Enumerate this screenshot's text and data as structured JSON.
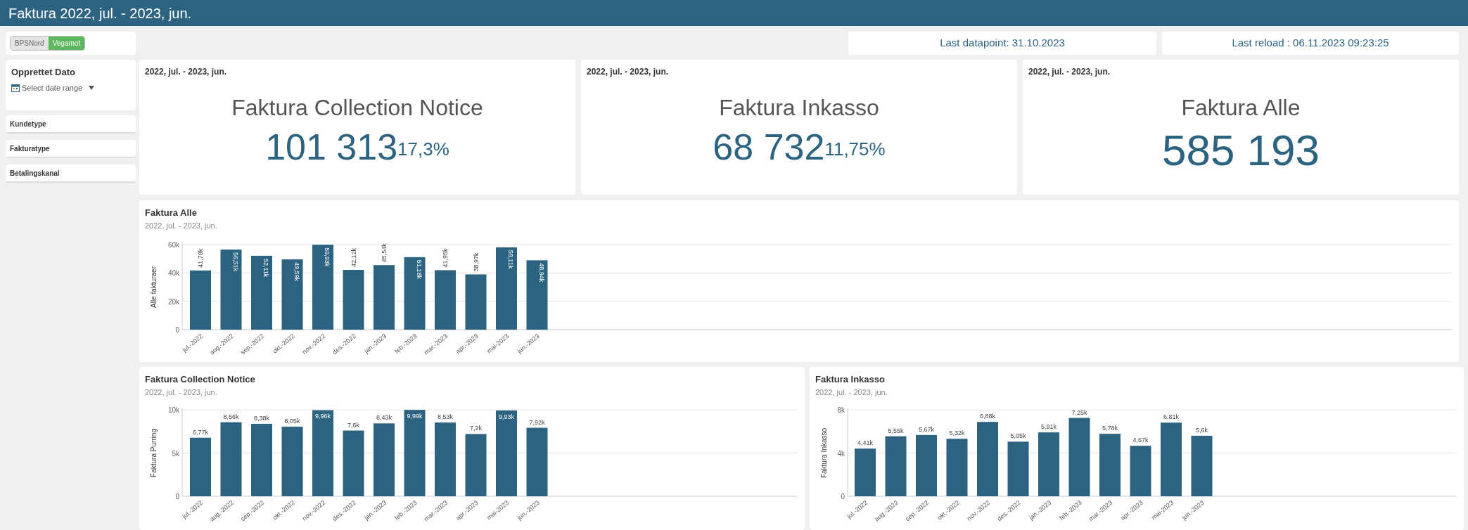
{
  "window": {
    "title": "Faktura 2022, jul. - 2023, jun."
  },
  "company_toggle": [
    {
      "label": "BPSNord",
      "selected": false
    },
    {
      "label": "Vegamot",
      "selected": true
    }
  ],
  "filters": {
    "date": {
      "title": "Opprettet Dato",
      "placeholder": "Select date range"
    },
    "items": [
      "Kundetype",
      "Fakturatype",
      "Betalingskanal"
    ]
  },
  "info": [
    "Last datapoint: 31.10.2023",
    "Last reload : 06.11.2023 09:23:25"
  ],
  "kpis": [
    {
      "period": "2022, jul. - 2023, jun.",
      "title": "Faktura Collection Notice",
      "value": "101 313",
      "percent": "17,3%"
    },
    {
      "period": "2022, jul. - 2023, jun.",
      "title": "Faktura Inkasso",
      "value": "68 732",
      "percent": "11,75%"
    },
    {
      "period": "2022, jul. - 2023, jun.",
      "title": "Faktura Alle",
      "value": "585 193"
    }
  ],
  "charts": [
    {
      "title": "Faktura Alle",
      "subtitle": "2022, jul. - 2023, jun.",
      "chart_data": {
        "type": "bar",
        "ylabel": "Alle fakturaer",
        "categories": [
          "jul.-2022",
          "aug.-2022",
          "sep.-2022",
          "okt.-2022",
          "nov.-2022",
          "des.-2022",
          "jan.-2023",
          "feb.-2023",
          "mar.-2023",
          "apr.-2023",
          "mai-2023",
          "jun.-2023"
        ],
        "values": [
          41780,
          56510,
          52110,
          49590,
          59930,
          42120,
          45540,
          51180,
          41950,
          38970,
          58110,
          48940
        ],
        "value_labels": [
          "41,78k",
          "56,51k",
          "52,11k",
          "49,59k",
          "59,93k",
          "42,12k",
          "45,54k",
          "51,18k",
          "41,95k",
          "38,97k",
          "58,11k",
          "48,94k"
        ],
        "ylim": [
          0,
          60000
        ],
        "yticks": [
          {
            "value": 0,
            "label": "0"
          },
          {
            "value": 20000,
            "label": "20k"
          },
          {
            "value": 40000,
            "label": "40k"
          },
          {
            "value": 60000,
            "label": "60k"
          }
        ]
      }
    },
    {
      "title": "Faktura Collection Notice",
      "subtitle": "2022, jul. - 2023, jun.",
      "chart_data": {
        "type": "bar",
        "ylabel": "Faktura Purring",
        "categories": [
          "jul.-2022",
          "aug.-2022",
          "sep.-2022",
          "okt.-2022",
          "nov.-2022",
          "des.-2022",
          "jan.-2023",
          "feb.-2023",
          "mar.-2023",
          "apr.-2023",
          "mai-2023",
          "jun.-2023"
        ],
        "values": [
          6770,
          8560,
          8380,
          8050,
          9960,
          7600,
          8430,
          9990,
          8530,
          7200,
          9930,
          7920
        ],
        "value_labels": [
          "6,77k",
          "8,56k",
          "8,38k",
          "8,05k",
          "9,96k",
          "7,6k",
          "8,43k",
          "9,99k",
          "8,53k",
          "7,2k",
          "9,93k",
          "7,92k"
        ],
        "ylim": [
          0,
          10000
        ],
        "yticks": [
          {
            "value": 0,
            "label": "0"
          },
          {
            "value": 5000,
            "label": "5k"
          },
          {
            "value": 10000,
            "label": "10k"
          }
        ]
      }
    },
    {
      "title": "Faktura Inkasso",
      "subtitle": "2022, jul. - 2023, jun.",
      "chart_data": {
        "type": "bar",
        "ylabel": "Faktura Inkasso",
        "categories": [
          "jul.-2022",
          "aug.-2022",
          "sep.-2022",
          "okt.-2022",
          "nov.-2022",
          "des.-2022",
          "jan.-2023",
          "feb.-2023",
          "mar.-2023",
          "apr.-2023",
          "mai-2023",
          "jun.-2023"
        ],
        "values": [
          4410,
          5550,
          5670,
          5320,
          6880,
          5050,
          5910,
          7250,
          5780,
          4670,
          6810,
          5600
        ],
        "value_labels": [
          "4,41k",
          "5,55k",
          "5,67k",
          "5,32k",
          "6,88k",
          "5,05k",
          "5,91k",
          "7,25k",
          "5,78k",
          "4,67k",
          "6,81k",
          "5,6k"
        ],
        "ylim": [
          0,
          8000
        ],
        "yticks": [
          {
            "value": 0,
            "label": "0"
          },
          {
            "value": 4000,
            "label": "4k"
          },
          {
            "value": 8000,
            "label": "8k"
          }
        ]
      }
    }
  ]
}
